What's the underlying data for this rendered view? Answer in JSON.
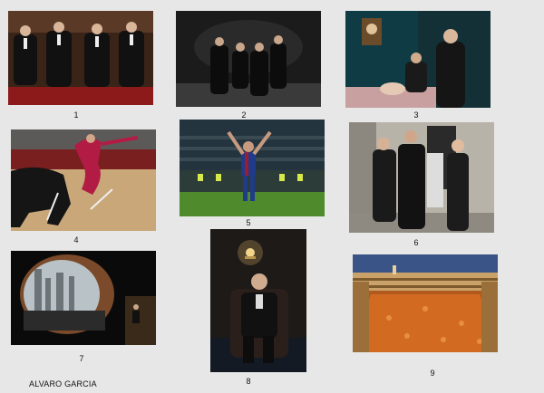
{
  "photos": [
    {
      "label": "1",
      "subject": "four-men-seated-red-room"
    },
    {
      "label": "2",
      "subject": "group-posed-dark-studio"
    },
    {
      "label": "3",
      "subject": "people-in-bedroom"
    },
    {
      "label": "4",
      "subject": "bullfighter-and-bull"
    },
    {
      "label": "5",
      "subject": "footballer-arms-raised-stadium"
    },
    {
      "label": "6",
      "subject": "people-on-street-corner"
    },
    {
      "label": "7",
      "subject": "city-towers-through-window"
    },
    {
      "label": "8",
      "subject": "man-seated-in-chair"
    },
    {
      "label": "9",
      "subject": "crowded-plaza-at-night"
    }
  ],
  "credit": "ALVARO GARCIA"
}
